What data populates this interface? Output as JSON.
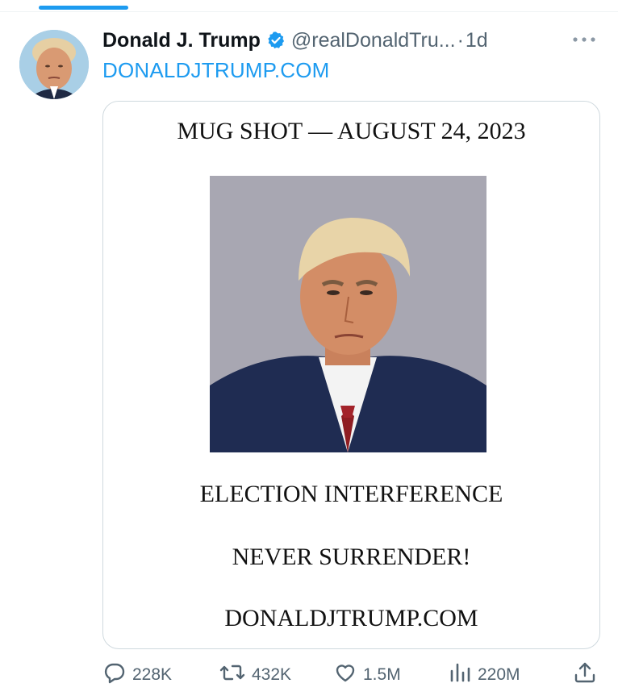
{
  "tweet": {
    "display_name": "Donald J. Trump",
    "handle": "@realDonaldTru...",
    "separator": "·",
    "timestamp": "1d",
    "link_text": "DONALDJTRUMP.COM"
  },
  "media": {
    "title": "MUG SHOT — AUGUST 24, 2023",
    "line1": "ELECTION INTERFERENCE",
    "line2": "NEVER SURRENDER!",
    "line3": "DONALDJTRUMP.COM"
  },
  "actions": {
    "replies": "228K",
    "reposts": "432K",
    "likes": "1.5M",
    "views": "220M"
  },
  "colors": {
    "accent": "#1d9bf0",
    "secondary_text": "#536471",
    "border": "#cfd9de"
  },
  "icons": [
    "verified-badge-icon",
    "more-icon",
    "reply-icon",
    "repost-icon",
    "like-icon",
    "views-icon",
    "share-icon"
  ]
}
